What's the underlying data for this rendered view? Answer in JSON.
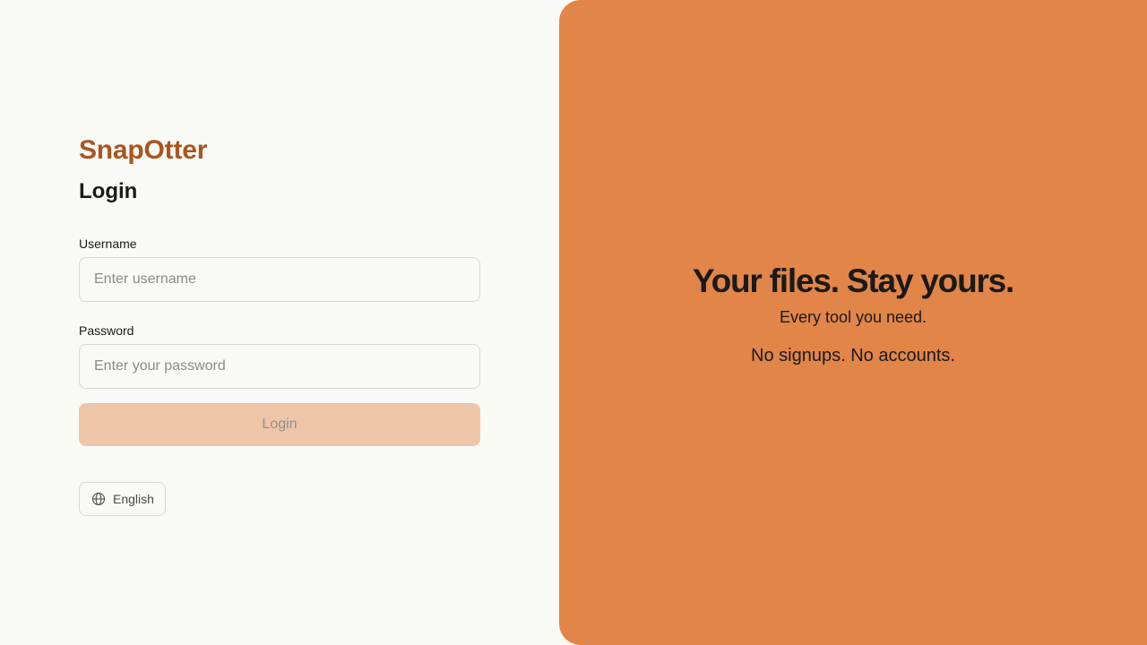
{
  "brand": {
    "name": "SnapOtter"
  },
  "login_form": {
    "title": "Login",
    "username": {
      "label": "Username",
      "value": "",
      "placeholder": "Enter username"
    },
    "password": {
      "label": "Password",
      "value": "",
      "placeholder": "Enter your password"
    },
    "submit_label": "Login"
  },
  "language_selector": {
    "icon": "globe-icon",
    "label": "English"
  },
  "hero": {
    "title": "Your files. Stay yours.",
    "subtitle": "Every tool you need.",
    "tagline": "No signups. No accounts."
  },
  "colors": {
    "brand": "#a8561d",
    "accent_panel": "#e28548",
    "button_disabled": "#efc5a8",
    "page_background": "#f9f9f6"
  }
}
